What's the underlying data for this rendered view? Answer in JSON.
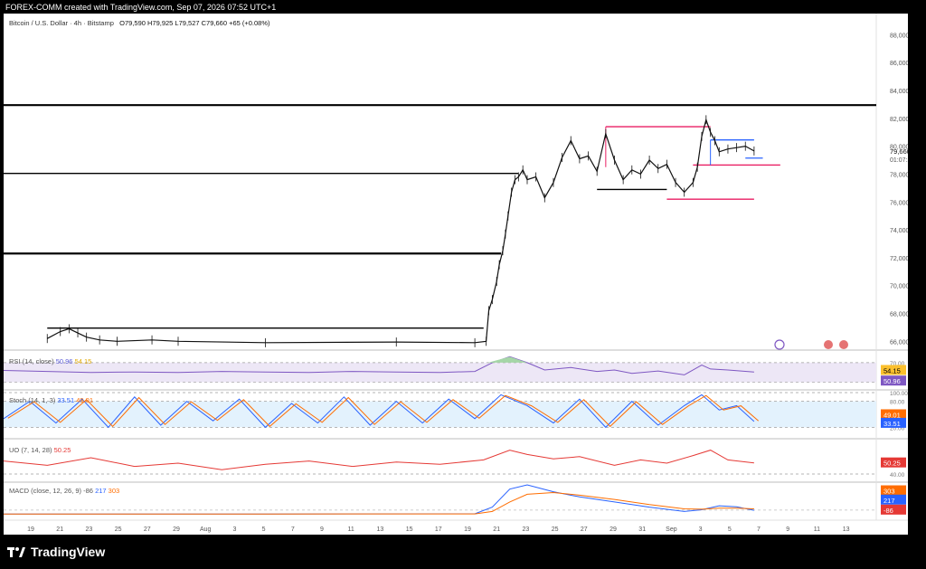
{
  "header": {
    "attribution": "FOREX-COMM created with TradingView.com, Sep 07, 2026 07:52 UTC+1"
  },
  "symbol": {
    "title": "Bitcoin / U.S. Dollar · 4h · Bitstamp",
    "ohlc": "O79,590  H79,925  L79,527  C79,660  +65 (+0.08%)"
  },
  "indicators": {
    "rsi": {
      "label": "RSI (14, close)",
      "v1": "50.96",
      "v2": "54.15"
    },
    "stoch": {
      "label": "Stoch (14, 1, 3)",
      "v1": "33.51",
      "v2": "49.01"
    },
    "uo": {
      "label": "UO (7, 14, 28)",
      "v1": "50.25"
    },
    "macd": {
      "label": "MACD (close, 12, 26, 9)",
      "v1": "-86",
      "v2": "217",
      "v3": "303"
    }
  },
  "colors": {
    "price_up": "#111111",
    "magenta": "#e91e63",
    "blue": "#2962ff",
    "rsi": "#7e57c2",
    "rsi_ma": "#fbc02d",
    "stoch_k": "#2962ff",
    "stoch_d": "#ff6d00",
    "uo": "#e53935",
    "macd": "#2962ff",
    "signal": "#ff6d00"
  },
  "price_labels": {
    "current": "79,660",
    "countdown": "01:07:27"
  },
  "pane_labels": {
    "rsi": [
      "54.15",
      "50.96"
    ],
    "stoch": [
      "49.01",
      "33.51"
    ],
    "uo": [
      "50.25"
    ],
    "macd": [
      "303",
      "217",
      "-86"
    ]
  },
  "footer": {
    "brand": "TradingView"
  },
  "chart_data": {
    "type": "line",
    "title": "Bitcoin / U.S. Dollar · 4h · Bitstamp",
    "price_axis": [
      "88,000",
      "86,000",
      "84,000",
      "82,000",
      "80,000",
      "78,000",
      "76,000",
      "74,000",
      "72,000",
      "70,000",
      "68,000",
      "66,000"
    ],
    "ylim": [
      65500,
      89000
    ],
    "x_ticks": [
      "19",
      "21",
      "23",
      "25",
      "27",
      "29",
      "Aug",
      "3",
      "5",
      "7",
      "9",
      "11",
      "13",
      "15",
      "17",
      "19",
      "21",
      "23",
      "25",
      "27",
      "29",
      "31",
      "Sep",
      "3",
      "5",
      "7",
      "9",
      "11",
      "13"
    ],
    "rsi_ticks": [
      "70.00",
      "30.00"
    ],
    "stoch_ticks": [
      "100.00",
      "80.00",
      "20.00"
    ],
    "uo_ticks": [
      "40.00"
    ],
    "horizontal_levels": [
      {
        "price": 82950,
        "x_start": 0,
        "x_end": 1
      },
      {
        "price": 78050,
        "x_start": 0,
        "x_end": 0.59
      },
      {
        "price": 72300,
        "x_start": 0,
        "x_end": 0.57
      },
      {
        "price": 66950,
        "x_start": 0.05,
        "x_end": 0.55
      },
      {
        "price": 76900,
        "x_start": 0.68,
        "x_end": 0.76
      },
      {
        "price": 81400,
        "x_start": 0.69,
        "x_end": 0.81,
        "color": "magenta"
      },
      {
        "price": 76200,
        "x_start": 0.76,
        "x_end": 0.86,
        "color": "magenta"
      },
      {
        "price": 78650,
        "x_start": 0.79,
        "x_end": 0.89,
        "color": "magenta"
      },
      {
        "price": 80450,
        "x_start": 0.81,
        "x_end": 0.86,
        "color": "blue"
      },
      {
        "price": 79150,
        "x_start": 0.85,
        "x_end": 0.87,
        "color": "blue"
      }
    ],
    "price_series": [
      [
        0.05,
        66200
      ],
      [
        0.065,
        66700
      ],
      [
        0.075,
        66900
      ],
      [
        0.085,
        66600
      ],
      [
        0.095,
        66300
      ],
      [
        0.11,
        66100
      ],
      [
        0.13,
        66000
      ],
      [
        0.17,
        66100
      ],
      [
        0.2,
        66000
      ],
      [
        0.3,
        65900
      ],
      [
        0.45,
        65950
      ],
      [
        0.54,
        65900
      ],
      [
        0.553,
        66000
      ],
      [
        0.556,
        68200
      ],
      [
        0.56,
        69000
      ],
      [
        0.565,
        70300
      ],
      [
        0.568,
        71500
      ],
      [
        0.572,
        72500
      ],
      [
        0.575,
        73700
      ],
      [
        0.578,
        75000
      ],
      [
        0.582,
        76700
      ],
      [
        0.586,
        77600
      ],
      [
        0.59,
        77800
      ],
      [
        0.595,
        78300
      ],
      [
        0.6,
        77600
      ],
      [
        0.61,
        77800
      ],
      [
        0.62,
        76300
      ],
      [
        0.63,
        77400
      ],
      [
        0.64,
        79200
      ],
      [
        0.65,
        80400
      ],
      [
        0.66,
        79100
      ],
      [
        0.67,
        79300
      ],
      [
        0.68,
        78200
      ],
      [
        0.69,
        80900
      ],
      [
        0.7,
        79000
      ],
      [
        0.71,
        77600
      ],
      [
        0.72,
        78300
      ],
      [
        0.73,
        78000
      ],
      [
        0.74,
        79000
      ],
      [
        0.75,
        78400
      ],
      [
        0.76,
        78700
      ],
      [
        0.77,
        77400
      ],
      [
        0.78,
        76700
      ],
      [
        0.79,
        77400
      ],
      [
        0.795,
        78500
      ],
      [
        0.8,
        80700
      ],
      [
        0.805,
        81900
      ],
      [
        0.81,
        81000
      ],
      [
        0.815,
        80400
      ],
      [
        0.82,
        79600
      ],
      [
        0.83,
        79800
      ],
      [
        0.84,
        79900
      ],
      [
        0.85,
        80000
      ],
      [
        0.86,
        79660
      ]
    ],
    "rsi_series": [
      [
        0,
        54
      ],
      [
        0.05,
        52
      ],
      [
        0.1,
        50
      ],
      [
        0.15,
        51
      ],
      [
        0.2,
        50
      ],
      [
        0.25,
        52
      ],
      [
        0.3,
        51
      ],
      [
        0.35,
        50
      ],
      [
        0.4,
        52
      ],
      [
        0.45,
        51
      ],
      [
        0.5,
        50
      ],
      [
        0.54,
        52
      ],
      [
        0.56,
        70
      ],
      [
        0.58,
        82
      ],
      [
        0.6,
        70
      ],
      [
        0.62,
        55
      ],
      [
        0.65,
        60
      ],
      [
        0.68,
        52
      ],
      [
        0.7,
        55
      ],
      [
        0.72,
        48
      ],
      [
        0.75,
        53
      ],
      [
        0.78,
        45
      ],
      [
        0.8,
        65
      ],
      [
        0.81,
        57
      ],
      [
        0.83,
        55
      ],
      [
        0.86,
        50.96
      ]
    ],
    "stoch_series": [
      [
        0,
        40
      ],
      [
        0.03,
        80
      ],
      [
        0.06,
        30
      ],
      [
        0.09,
        85
      ],
      [
        0.12,
        20
      ],
      [
        0.15,
        90
      ],
      [
        0.18,
        25
      ],
      [
        0.21,
        80
      ],
      [
        0.24,
        35
      ],
      [
        0.27,
        85
      ],
      [
        0.3,
        20
      ],
      [
        0.33,
        75
      ],
      [
        0.36,
        30
      ],
      [
        0.39,
        90
      ],
      [
        0.42,
        25
      ],
      [
        0.45,
        80
      ],
      [
        0.48,
        30
      ],
      [
        0.51,
        85
      ],
      [
        0.54,
        40
      ],
      [
        0.57,
        95
      ],
      [
        0.6,
        70
      ],
      [
        0.63,
        30
      ],
      [
        0.66,
        85
      ],
      [
        0.69,
        20
      ],
      [
        0.72,
        80
      ],
      [
        0.75,
        25
      ],
      [
        0.78,
        70
      ],
      [
        0.8,
        95
      ],
      [
        0.82,
        60
      ],
      [
        0.84,
        70
      ],
      [
        0.86,
        33.51
      ]
    ],
    "uo_series": [
      [
        0,
        52
      ],
      [
        0.05,
        48
      ],
      [
        0.1,
        55
      ],
      [
        0.15,
        47
      ],
      [
        0.2,
        50
      ],
      [
        0.25,
        44
      ],
      [
        0.3,
        49
      ],
      [
        0.35,
        52
      ],
      [
        0.4,
        47
      ],
      [
        0.45,
        51
      ],
      [
        0.5,
        49
      ],
      [
        0.55,
        53
      ],
      [
        0.58,
        62
      ],
      [
        0.6,
        58
      ],
      [
        0.63,
        54
      ],
      [
        0.66,
        56
      ],
      [
        0.7,
        48
      ],
      [
        0.73,
        53
      ],
      [
        0.76,
        50
      ],
      [
        0.79,
        57
      ],
      [
        0.81,
        62
      ],
      [
        0.83,
        53
      ],
      [
        0.86,
        50.25
      ]
    ],
    "macd_series": [
      [
        0,
        0
      ],
      [
        0.3,
        0
      ],
      [
        0.54,
        10
      ],
      [
        0.56,
        400
      ],
      [
        0.58,
        1450
      ],
      [
        0.6,
        1700
      ],
      [
        0.63,
        1300
      ],
      [
        0.66,
        1000
      ],
      [
        0.7,
        700
      ],
      [
        0.74,
        400
      ],
      [
        0.78,
        150
      ],
      [
        0.8,
        250
      ],
      [
        0.82,
        480
      ],
      [
        0.84,
        420
      ],
      [
        0.86,
        217
      ]
    ],
    "signal_series": [
      [
        0,
        0
      ],
      [
        0.3,
        0
      ],
      [
        0.54,
        5
      ],
      [
        0.56,
        150
      ],
      [
        0.58,
        700
      ],
      [
        0.6,
        1150
      ],
      [
        0.63,
        1250
      ],
      [
        0.66,
        1100
      ],
      [
        0.7,
        850
      ],
      [
        0.74,
        550
      ],
      [
        0.78,
        300
      ],
      [
        0.8,
        280
      ],
      [
        0.82,
        340
      ],
      [
        0.84,
        340
      ],
      [
        0.86,
        303
      ]
    ]
  }
}
